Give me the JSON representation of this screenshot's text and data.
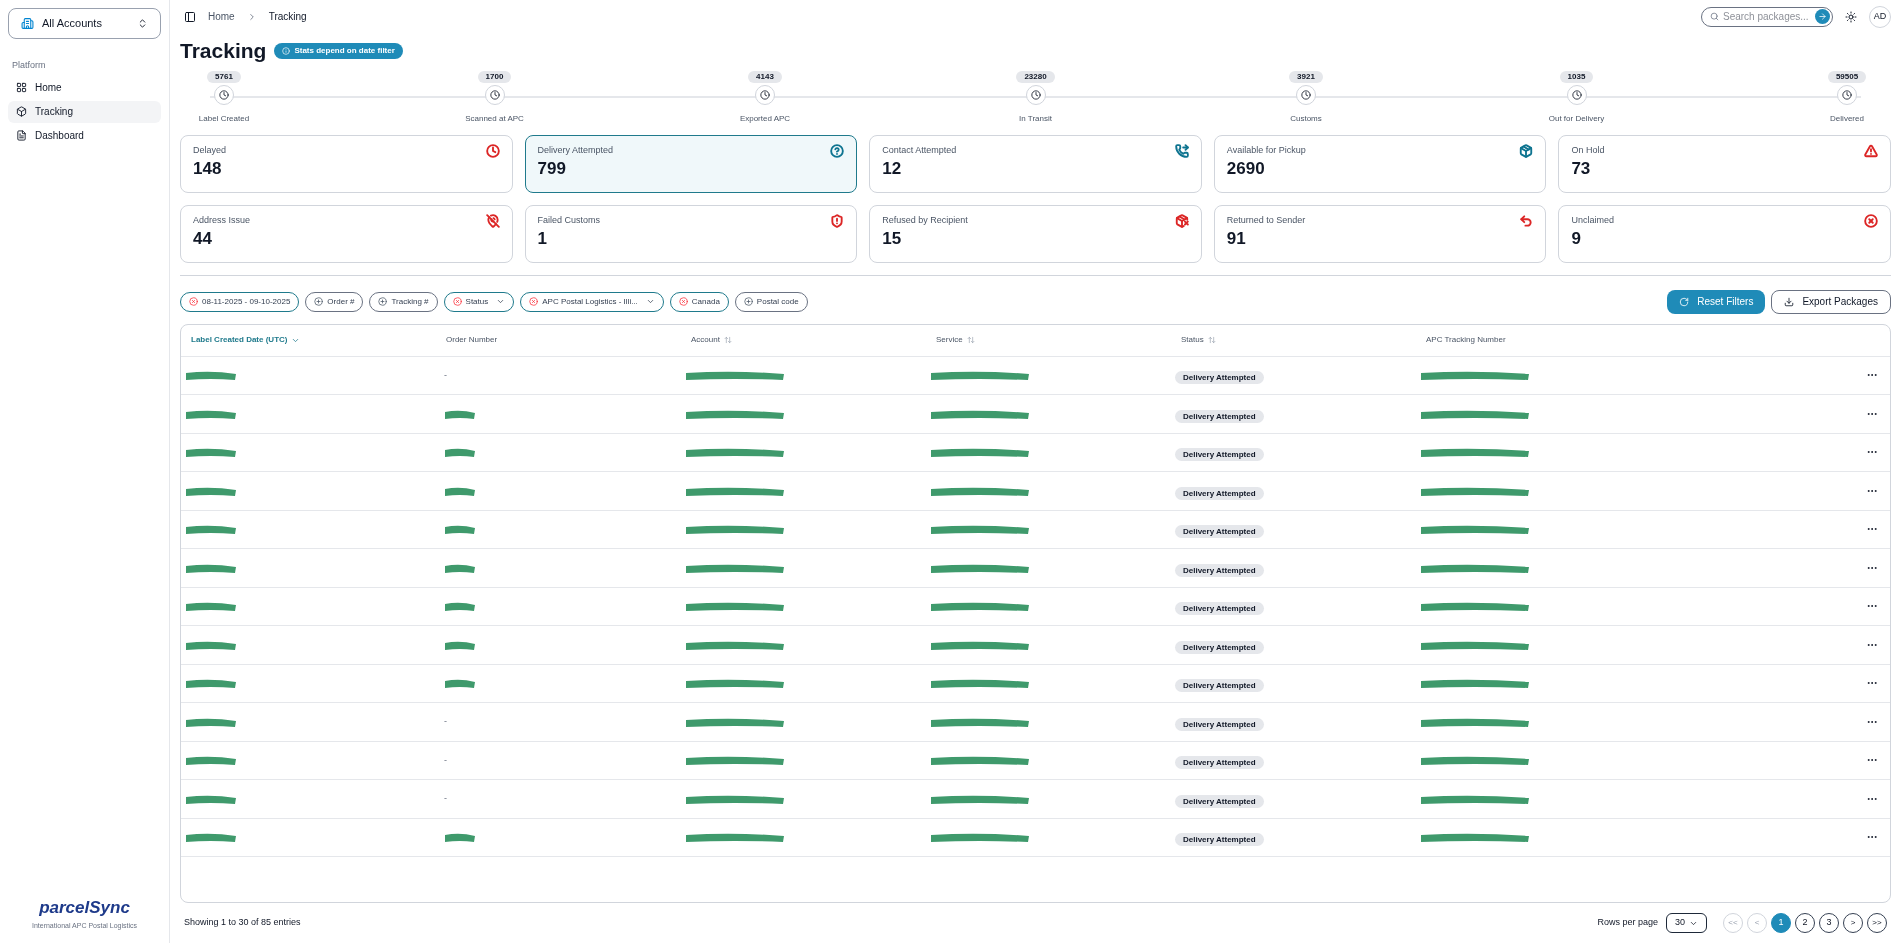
{
  "sidebar": {
    "account_switcher": "All Accounts",
    "section_label": "Platform",
    "items": [
      {
        "label": "Home",
        "selected": false
      },
      {
        "label": "Tracking",
        "selected": true
      },
      {
        "label": "Dashboard",
        "selected": false
      }
    ]
  },
  "breadcrumb": [
    "Home",
    "Tracking"
  ],
  "search": {
    "placeholder": "Search packages..."
  },
  "avatar": "AD",
  "page_title": "Tracking",
  "info_badge": "Stats depend on date filter",
  "stages": [
    {
      "count": "5761",
      "label": "Label Created"
    },
    {
      "count": "1700",
      "label": "Scanned at APC"
    },
    {
      "count": "4143",
      "label": "Exported APC"
    },
    {
      "count": "23280",
      "label": "In Transit"
    },
    {
      "count": "3921",
      "label": "Customs"
    },
    {
      "count": "1035",
      "label": "Out for Delivery"
    },
    {
      "count": "59505",
      "label": "Delivered"
    }
  ],
  "stat_cards": [
    {
      "label": "Delayed",
      "value": "148",
      "color": "#dc2626",
      "selected": false
    },
    {
      "label": "Delivery Attempted",
      "value": "799",
      "color": "#0e7490",
      "selected": true
    },
    {
      "label": "Contact Attempted",
      "value": "12",
      "color": "#0e7490",
      "selected": false
    },
    {
      "label": "Available for Pickup",
      "value": "2690",
      "color": "#0e7490",
      "selected": false
    },
    {
      "label": "On Hold",
      "value": "73",
      "color": "#dc2626",
      "selected": false
    },
    {
      "label": "Address Issue",
      "value": "44",
      "color": "#dc2626",
      "selected": false
    },
    {
      "label": "Failed Customs",
      "value": "1",
      "color": "#dc2626",
      "selected": false
    },
    {
      "label": "Refused by Recipient",
      "value": "15",
      "color": "#dc2626",
      "selected": false
    },
    {
      "label": "Returned to Sender",
      "value": "91",
      "color": "#dc2626",
      "selected": false
    },
    {
      "label": "Unclaimed",
      "value": "9",
      "color": "#dc2626",
      "selected": false
    }
  ],
  "filters": [
    {
      "label": "08-11-2025 - 09-10-2025",
      "active": true,
      "dropdown": false
    },
    {
      "label": "Order #",
      "active": false,
      "dropdown": false
    },
    {
      "label": "Tracking #",
      "active": false,
      "dropdown": false
    },
    {
      "label": "Status",
      "active": true,
      "dropdown": true
    },
    {
      "label": "APC Postal Logistics - Illi...",
      "active": true,
      "dropdown": true
    },
    {
      "label": "Canada",
      "active": true,
      "dropdown": false
    },
    {
      "label": "Postal code",
      "active": false,
      "dropdown": false
    }
  ],
  "actions": [
    {
      "label": "Reset Filters",
      "kind": "primary"
    },
    {
      "label": "Export Packages",
      "kind": "outline"
    }
  ],
  "table": {
    "columns": [
      {
        "label": "Label Created Date (UTC)",
        "sortable": true,
        "sorted": true
      },
      {
        "label": "Order Number",
        "sortable": false,
        "sorted": false
      },
      {
        "label": "Account",
        "sortable": true,
        "sorted": false
      },
      {
        "label": "Service",
        "sortable": true,
        "sorted": false
      },
      {
        "label": "Status",
        "sortable": true,
        "sorted": false
      },
      {
        "label": "APC Tracking Number",
        "sortable": false,
        "sorted": false
      }
    ],
    "rows": [
      {
        "order_number": "-",
        "status": "Delivery Attempted"
      },
      {
        "status": "Delivery Attempted"
      },
      {
        "status": "Delivery Attempted"
      },
      {
        "status": "Delivery Attempted"
      },
      {
        "status": "Delivery Attempted"
      },
      {
        "status": "Delivery Attempted"
      },
      {
        "status": "Delivery Attempted"
      },
      {
        "status": "Delivery Attempted"
      },
      {
        "status": "Delivery Attempted"
      },
      {
        "order_number": "-",
        "status": "Delivery Attempted"
      },
      {
        "order_number": "-",
        "status": "Delivery Attempted"
      },
      {
        "order_number": "-",
        "status": "Delivery Attempted"
      },
      {
        "status": "Delivery Attempted"
      }
    ]
  },
  "footer": {
    "summary": "Showing 1 to 30 of 85 entries",
    "rows_per_page_label": "Rows per page",
    "rows_per_page": "30",
    "nav_first": "<<",
    "nav_prev": "<",
    "nav_next": ">",
    "nav_last": ">>",
    "pages": [
      {
        "label": "1",
        "selected": true
      },
      {
        "label": "2",
        "selected": false
      },
      {
        "label": "3",
        "selected": false
      }
    ]
  },
  "logo": {
    "name_a": "parcel",
    "name_b": "Sync",
    "tagline": "International APC Postal Logistics"
  }
}
